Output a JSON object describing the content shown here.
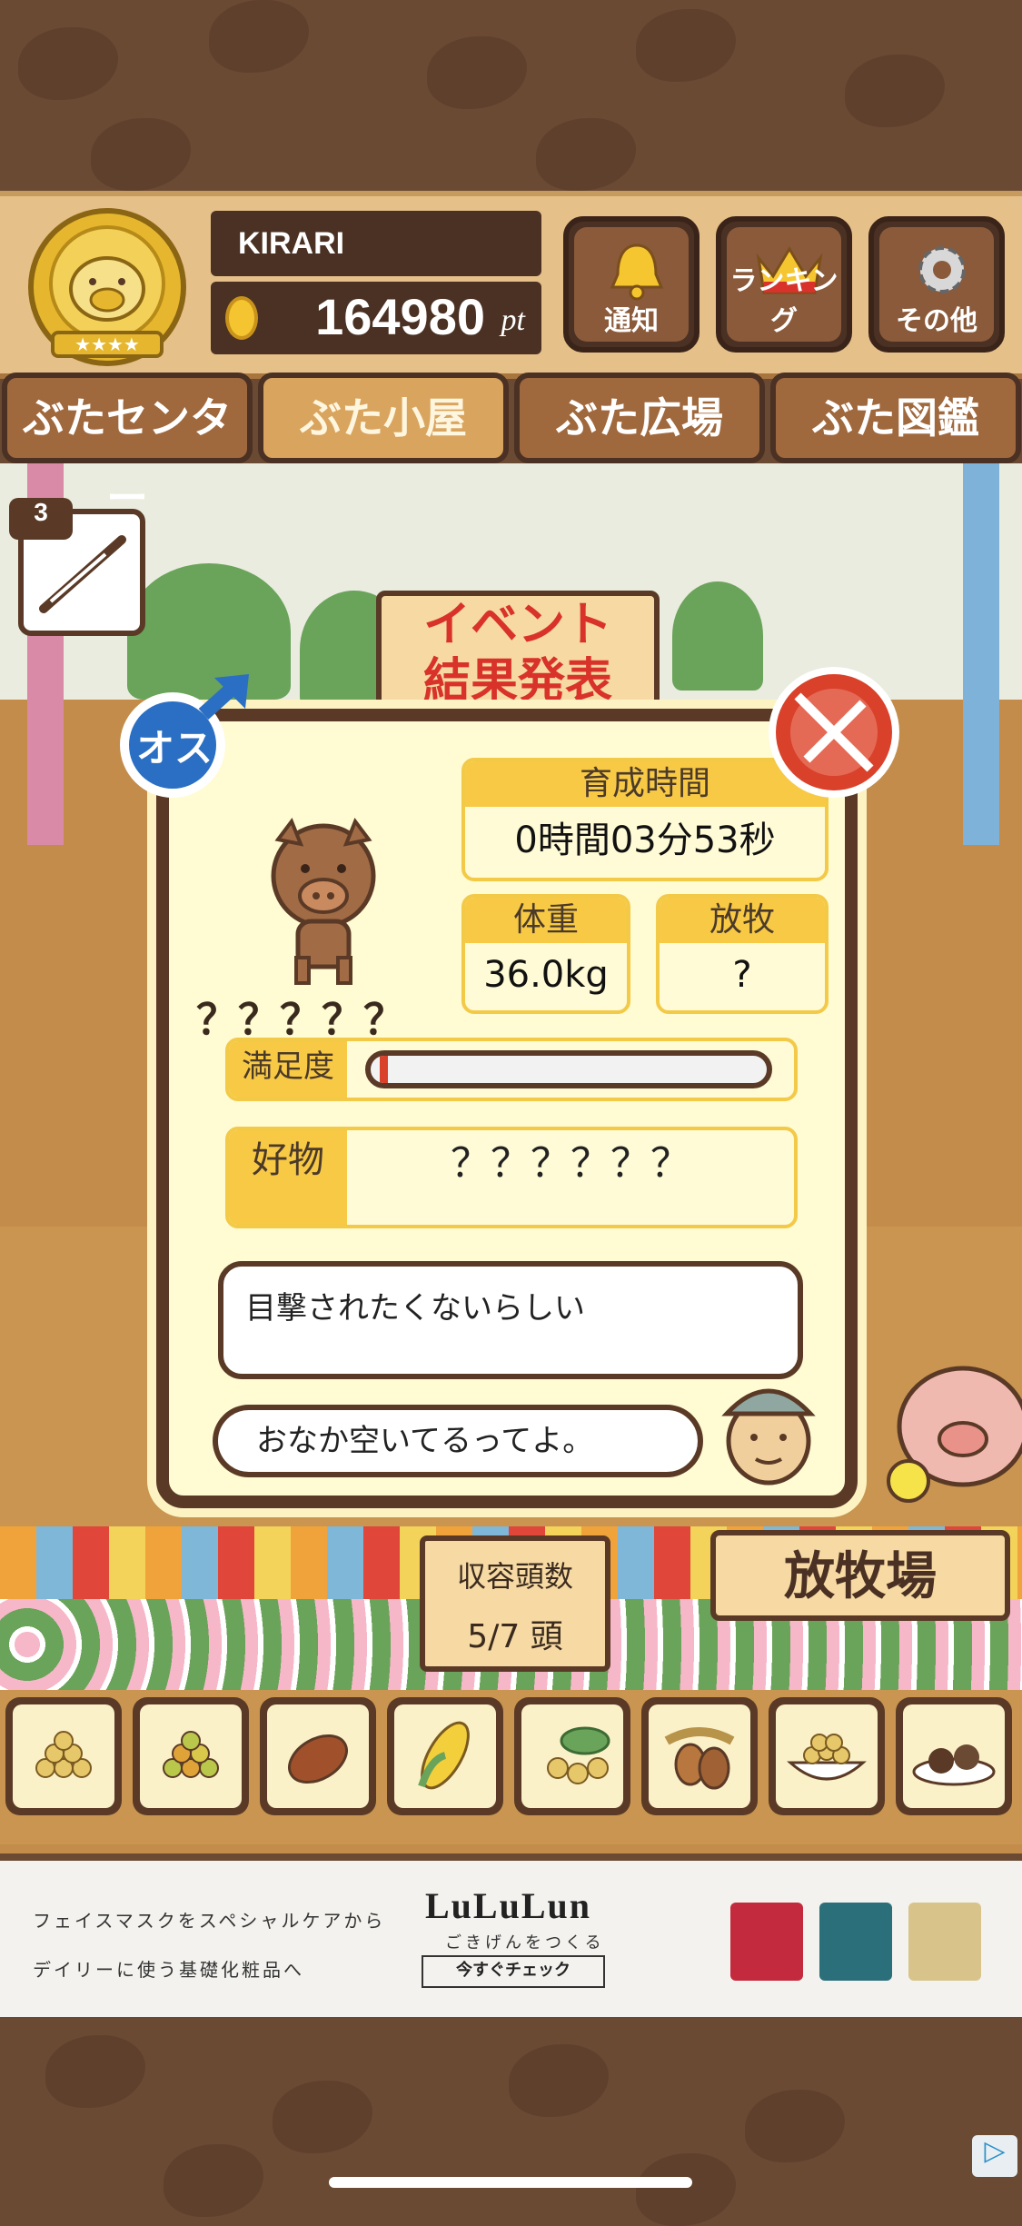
{
  "header": {
    "player_name": "KIRARI",
    "points": "164980",
    "points_unit": "pt",
    "buttons": [
      {
        "label": "通知",
        "icon": "bell-icon"
      },
      {
        "label": "ランキング",
        "icon": "crown-icon"
      },
      {
        "label": "その他",
        "icon": "gear-icon"
      }
    ]
  },
  "tabs": [
    "ぶたセンター",
    "ぶた小屋",
    "ぶた広場",
    "ぶた図鑑"
  ],
  "active_tab": "ぶた小屋",
  "syringe_count": "3",
  "event_sign": {
    "line1": "イベント",
    "line2": "結果発表"
  },
  "pig": {
    "gender_label": "オス",
    "name": "？？？？？",
    "stats": {
      "growth_time_label": "育成時間",
      "growth_time": "0時間03分53秒",
      "weight_label": "体重",
      "weight": "36.0kg",
      "grazing_label": "放牧",
      "grazing": "?"
    },
    "satisfaction_label": "満足度",
    "satisfaction_level": 0.02,
    "favorite_label": "好物",
    "favorite": "？？？？？？",
    "comment": "目撃されたくないらしい",
    "farmer_speech": "おなか空いてるってよ。"
  },
  "capacity": {
    "label": "収容頭数",
    "value": "5/7 頭"
  },
  "pasture_sign": "放牧場",
  "food_items": [
    "soybeans-icon",
    "mixed-beans-icon",
    "sweet-potato-icon",
    "corn-icon",
    "leaf-nuts-icon",
    "acorn-icon",
    "bean-bowl-icon",
    "meatball-plate-icon"
  ],
  "ad": {
    "line1": "フェイスマスクをスペシャルケアから",
    "line2": "デイリーに使う基礎化粧品へ",
    "brand": "LuLuLun",
    "tagline": "ごきげんをつくる",
    "cta": "今すぐチェック"
  },
  "colors": {
    "accent": "#f7c944",
    "brown": "#5a3a26",
    "male_blue": "#2a6fc4",
    "no_syringe_red": "#d9412b"
  }
}
